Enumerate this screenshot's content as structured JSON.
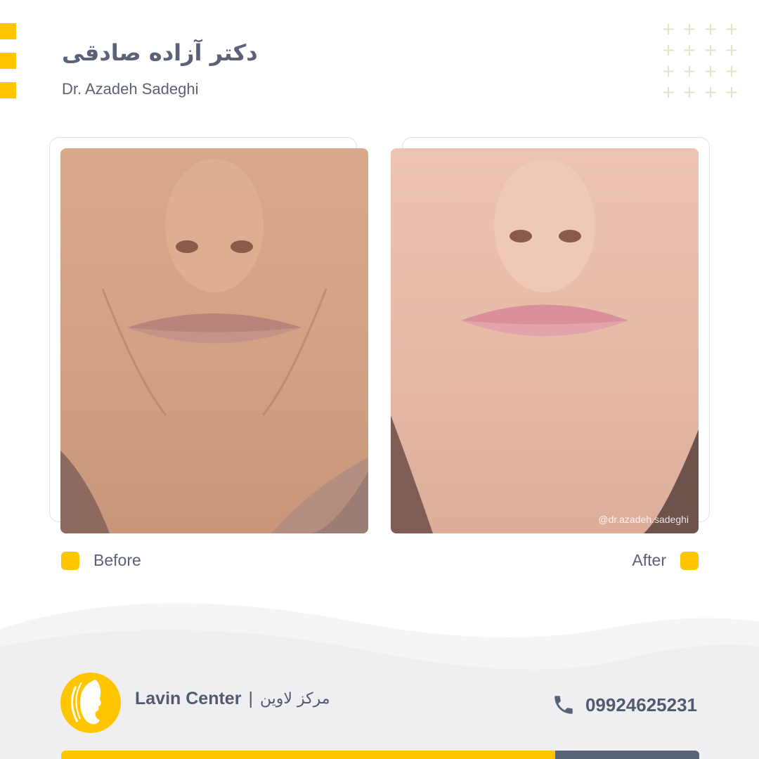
{
  "header": {
    "title_fa": "دکتر آزاده صادقی",
    "title_en": "Dr. Azadeh Sadeghi"
  },
  "photos": {
    "before_label": "Before",
    "after_label": "After",
    "watermark": "@dr.azadeh.sadeghi"
  },
  "footer": {
    "brand_en": "Lavin Center",
    "separator": "|",
    "brand_fa": "مرکز لاوین",
    "phone": "09924625231"
  },
  "colors": {
    "accent": "#ffc600",
    "text": "#5b6277",
    "footer_bg": "#f2f2f4"
  },
  "icons": [
    "plus-icon",
    "phone-icon",
    "lavin-logo-icon"
  ]
}
